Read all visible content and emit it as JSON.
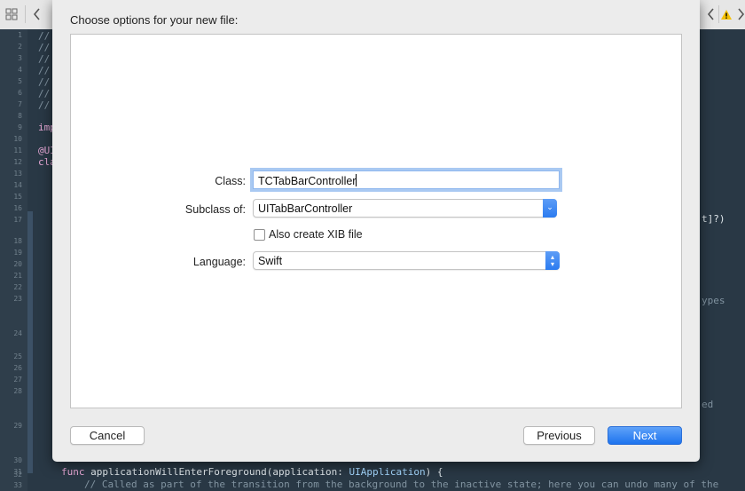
{
  "sheet": {
    "title": "Choose options for your new file:",
    "class_label": "Class:",
    "class_value": "TCTabBarController",
    "subclass_label": "Subclass of:",
    "subclass_value": "UITabBarController",
    "xib_label": "Also create XIB file",
    "xib_checked": false,
    "language_label": "Language:",
    "language_value": "Swift",
    "cancel": "Cancel",
    "previous": "Previous",
    "next": "Next"
  },
  "toolbar": {
    "left_icons": [
      "grid-icon",
      "back-chevron-icon"
    ],
    "right_icons": [
      "back-chevron-icon",
      "warning-icon",
      "forward-chevron-icon"
    ]
  },
  "editor": {
    "line_numbers": [
      "1",
      "2",
      "3",
      "4",
      "5",
      "6",
      "7",
      "8",
      "9",
      "10",
      "11",
      "12",
      "13",
      "14",
      "15",
      "16",
      "17",
      "18",
      "19",
      "20",
      "21",
      "22",
      "23",
      "24",
      "25",
      "26",
      "27",
      "28",
      "29",
      "30",
      "31",
      "32",
      "33"
    ],
    "fragments": {
      "c1": "//",
      "c2": "//",
      "c3": "//",
      "c4": "//",
      "c5": "//",
      "c6": "//",
      "c7": "//",
      "imp": "imp",
      "ui": "@UI",
      "cla": "cla",
      "right1": "t]?)",
      "right2": "ypes",
      "right3": "ed"
    },
    "func_kw": "func",
    "func_name": " applicationWillEnterForeground(application: ",
    "func_type": "UIApplication",
    "func_end": ") {",
    "comment_line": "// Called as part of the transition from the background to the inactive state; here you can undo many of the"
  },
  "colors": {
    "editor_bg": "#293845",
    "sheet_bg": "#ececec",
    "accent": "#2b7bf0"
  }
}
